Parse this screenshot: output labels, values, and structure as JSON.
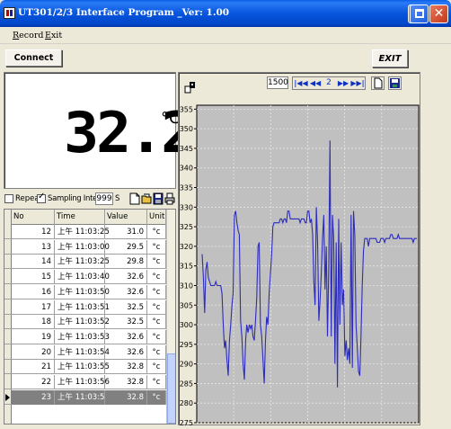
{
  "window": {
    "title": "UT301/2/3 Interface Program _Ver: 1.00"
  },
  "menu": {
    "items": [
      "Record",
      "Exit"
    ]
  },
  "toolbar": {
    "connect_label": "Connect",
    "exit_label": "EXIT"
  },
  "display": {
    "value": "32.2",
    "unit": "°C"
  },
  "controls": {
    "repeat_label": "Repeat",
    "repeat_checked": false,
    "sampling_label": "Sampling Interval",
    "sampling_checked": true,
    "interval_value": "999",
    "interval_unit": "S"
  },
  "table": {
    "columns": [
      "No",
      "Time",
      "Value",
      "Unit"
    ],
    "rows": [
      {
        "no": "12",
        "time": "上午 11:03:25",
        "value": "31.0",
        "unit": "°c"
      },
      {
        "no": "13",
        "time": "上午 11:03:00",
        "value": "29.5",
        "unit": "°c"
      },
      {
        "no": "14",
        "time": "上午 11:03:25",
        "value": "29.8",
        "unit": "°c"
      },
      {
        "no": "15",
        "time": "上午 11:03:40",
        "value": "32.6",
        "unit": "°c"
      },
      {
        "no": "16",
        "time": "上午 11:03:50",
        "value": "32.6",
        "unit": "°c"
      },
      {
        "no": "17",
        "time": "上午 11:03:51",
        "value": "32.5",
        "unit": "°c"
      },
      {
        "no": "18",
        "time": "上午 11:03:52",
        "value": "32.5",
        "unit": "°c"
      },
      {
        "no": "19",
        "time": "上午 11:03:53",
        "value": "32.6",
        "unit": "°c"
      },
      {
        "no": "20",
        "time": "上午 11:03:54",
        "value": "32.6",
        "unit": "°c"
      },
      {
        "no": "21",
        "time": "上午 11:03:55",
        "value": "32.8",
        "unit": "°c"
      },
      {
        "no": "22",
        "time": "上午 11:03:56",
        "value": "32.8",
        "unit": "°c"
      },
      {
        "no": "23",
        "time": "上午 11:03:57",
        "value": "32.8",
        "unit": "°c"
      }
    ],
    "selected_row": "23"
  },
  "chart_controls": {
    "count": "1500",
    "page": "2",
    "first_icon": "skip-first-icon",
    "prev_icon": "rewind-icon",
    "next_icon": "fast-forward-icon",
    "last_icon": "skip-last-icon"
  },
  "chart_data": {
    "type": "line",
    "y_ticks": [
      "355",
      "350",
      "345",
      "340",
      "335",
      "330",
      "325",
      "320",
      "315",
      "310",
      "305",
      "300",
      "295",
      "290",
      "285",
      "280",
      "275"
    ],
    "ylim": [
      275,
      356
    ],
    "grid": true,
    "line_color": "#2b2bbd",
    "plot_background": "#c0c0c0",
    "series": [
      {
        "values": [
          318,
          312,
          303,
          314,
          316,
          312,
          311,
          310,
          310,
          310,
          310,
          311,
          310,
          310,
          310,
          310,
          308,
          300,
          294,
          296,
          291,
          287,
          296,
          300,
          305,
          308,
          328,
          329,
          326,
          324,
          323,
          301,
          297,
          290,
          286,
          296,
          300,
          298,
          300,
          299,
          300,
          297,
          296,
          301,
          307,
          320,
          321,
          300,
          297,
          291,
          285,
          296,
          302,
          300,
          308,
          313,
          318,
          325,
          326,
          326,
          326,
          326,
          326,
          327,
          327,
          326,
          327,
          327,
          326,
          329,
          329,
          327,
          327,
          327,
          327,
          327,
          327,
          327,
          327,
          326,
          327,
          327,
          327,
          326,
          326,
          329,
          329,
          326,
          327,
          323,
          311,
          305,
          330,
          321,
          301,
          306,
          313,
          322,
          328,
          309,
          320,
          297,
          314,
          347,
          297,
          328,
          322,
          290,
          321,
          284,
          327,
          300,
          321,
          305,
          309,
          292,
          296,
          291,
          294,
          290,
          328,
          289,
          329,
          323,
          300,
          294,
          288,
          287,
          297,
          310,
          319,
          322,
          322,
          322,
          320,
          322,
          322,
          322,
          322,
          322,
          322,
          321,
          321,
          321,
          322,
          322,
          322,
          321,
          322,
          322,
          322,
          322,
          323,
          323,
          322,
          322,
          322,
          322,
          323,
          322,
          322,
          322,
          322,
          322,
          322,
          322,
          322,
          322,
          322,
          322,
          321,
          322,
          322,
          322
        ]
      }
    ]
  }
}
